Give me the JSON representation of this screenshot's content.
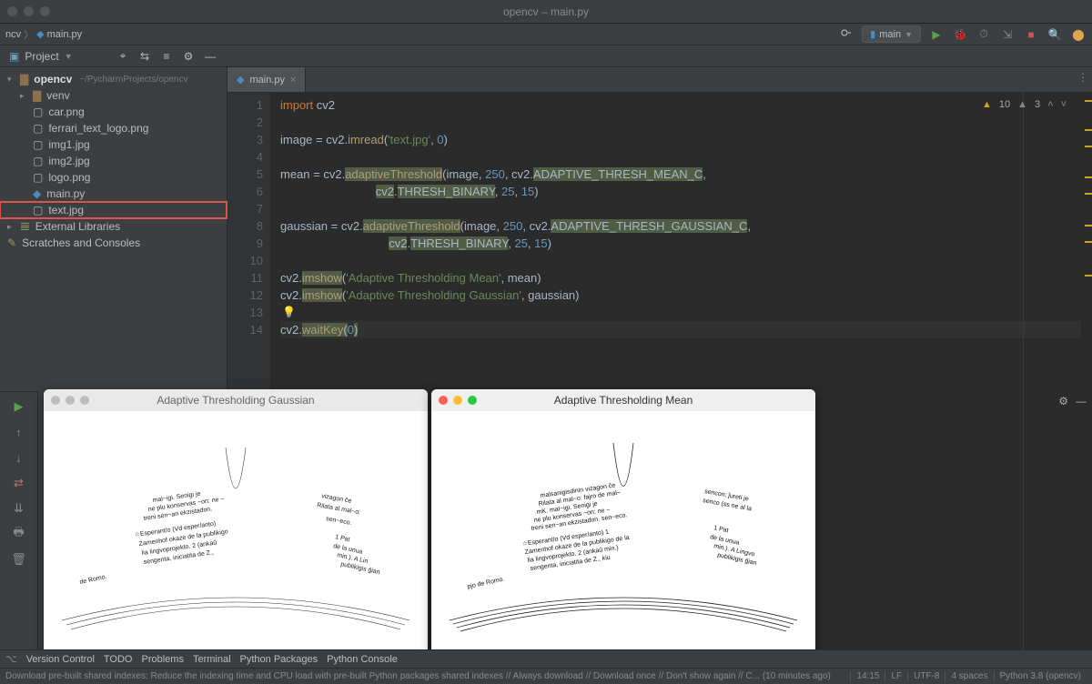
{
  "window": {
    "title": "opencv – main.py"
  },
  "breadcrumb": {
    "project": "ncv",
    "file": "main.py"
  },
  "run_config": {
    "label": "main"
  },
  "inspections": {
    "warnings": 10,
    "weak": 3
  },
  "project_panel": {
    "label": "Project",
    "root": {
      "name": "opencv",
      "path": "~/PycharmProjects/opencv"
    },
    "venv": "venv",
    "files": [
      "car.png",
      "ferrari_text_logo.png",
      "img1.jpg",
      "img2.jpg",
      "logo.png",
      "main.py",
      "text.jpg"
    ],
    "external": "External Libraries",
    "scratches": "Scratches and Consoles"
  },
  "tabs": [
    {
      "label": "main.py"
    }
  ],
  "code_lines": 14,
  "image_windows": {
    "gaussian": "Adaptive Thresholding Gaussian",
    "mean": "Adaptive Thresholding Mean"
  },
  "version_control": {
    "label": "Version Control",
    "todo": "TODO",
    "problems": "Problems",
    "terminal": "Terminal",
    "python_packages": "Python Packages",
    "python_console": "Python Console"
  },
  "status": {
    "msg": "Download pre-built shared indexes: Reduce the indexing time and CPU load with pre-built Python packages shared indexes // Always download // Download once // Don't show again // C... (10 minutes ago)",
    "line_col": "14:15",
    "eol": "LF",
    "encoding": "UTF-8",
    "indent": "4 spaces",
    "interpreter": "Python 3.8 (opencv)"
  }
}
